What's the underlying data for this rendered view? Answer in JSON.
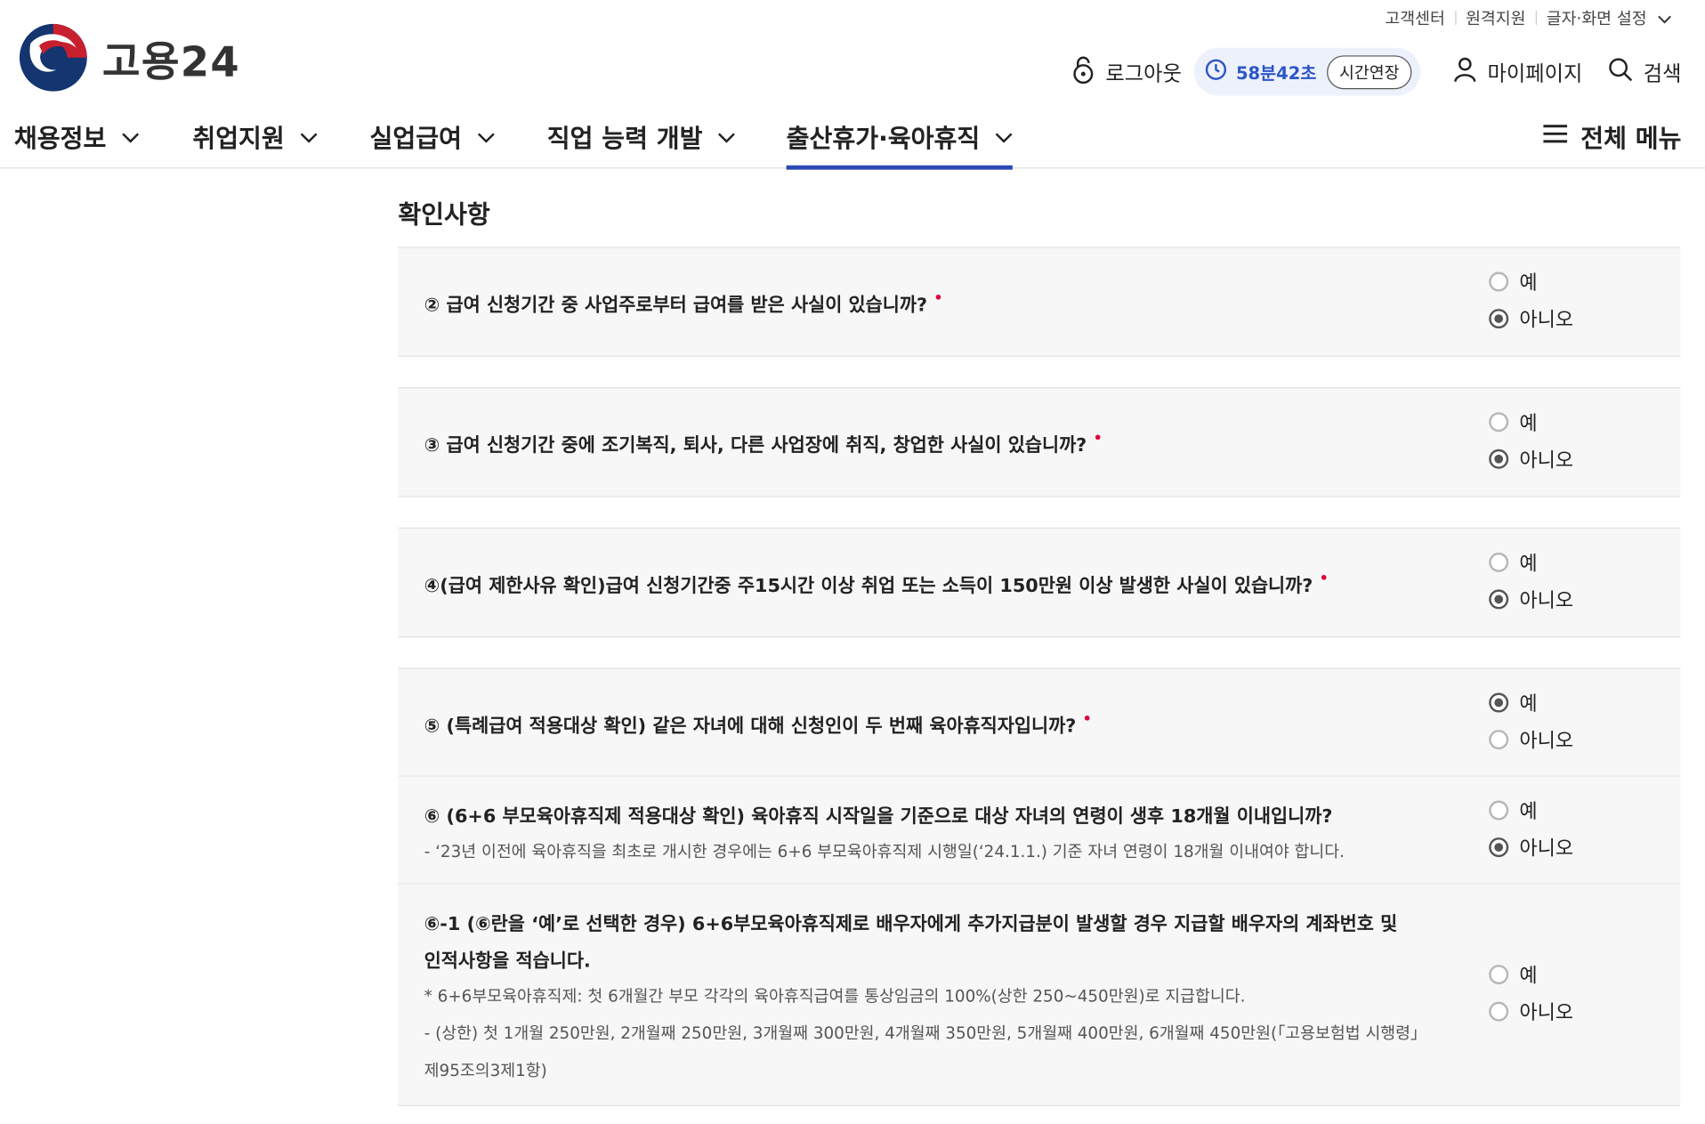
{
  "util": {
    "customer_center": "고객센터",
    "remote_support": "원격지원",
    "display_settings": "글자·화면 설정"
  },
  "logo": {
    "text": "고용24"
  },
  "header": {
    "logout": "로그아웃",
    "timer": "58분42초",
    "extend": "시간연장",
    "mypage": "마이페이지",
    "search": "검색"
  },
  "nav": {
    "items": [
      "채용정보",
      "취업지원",
      "실업급여",
      "직업 능력 개발",
      "출산휴가·육아휴직"
    ],
    "active": "출산휴가·육아휴직",
    "all_menu": "전체 메뉴"
  },
  "section": {
    "title": "확인사항"
  },
  "radio_labels": {
    "yes": "예",
    "no": "아니오"
  },
  "questions": [
    {
      "text": "② 급여 신청기간 중 사업주로부터 급여를 받은 사실이 있습니까?",
      "required": "•",
      "selected": "no"
    },
    {
      "text": "③ 급여 신청기간 중에 조기복직, 퇴사, 다른 사업장에 취직, 창업한 사실이 있습니까?",
      "required": "•",
      "selected": "no"
    },
    {
      "text": "④(급여 제한사유 확인)급여 신청기간중 주15시간 이상 취업 또는 소득이 150만원 이상 발생한 사실이 있습니까?",
      "required": "•",
      "selected": "no"
    },
    {
      "text": "⑤ (특례급여 적용대상 확인) 같은 자녀에 대해 신청인이 두 번째 육아휴직자입니까?",
      "required": "•",
      "selected": "yes"
    },
    {
      "text": "⑥ (6+6 부모육아휴직제 적용대상 확인) 육아휴직 시작일을 기준으로 대상 자녀의 연령이 생후 18개월 이내입니까?",
      "note": "- ‘23년 이전에 육아휴직을 최초로 개시한 경우에는 6+6 부모육아휴직제 시행일(‘24.1.1.) 기준 자녀 연령이 18개월 이내여야 합니다.",
      "selected": "no"
    },
    {
      "text_line1": "⑥-1 (⑥란을 ‘예’로 선택한 경우) 6+6부모육아휴직제로 배우자에게 추가지급분이 발생할 경우 지급할 배우자의 계좌번호 및",
      "text_line2": "인적사항을 적습니다.",
      "note1": "* 6+6부모육아휴직제: 첫 6개월간 부모 각각의 육아휴직급여를 통상임금의 100%(상한 250~450만원)로 지급합니다.",
      "note2": "- (상한) 첫 1개월 250만원, 2개월째 250만원, 3개월째 300만원, 4개월째 350만원, 5개월째 400만원, 6개월째 450만원(「고용보험법 시행령」",
      "note3": "제95조의3제1항)",
      "selected": "none"
    }
  ]
}
